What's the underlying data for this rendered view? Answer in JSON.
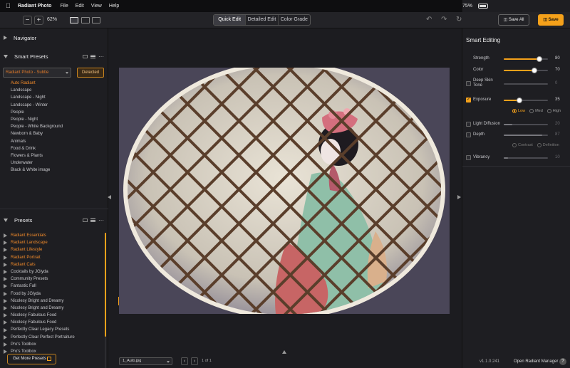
{
  "menubar": {
    "app_name": "Radiant Photo",
    "items": [
      "File",
      "Edit",
      "View",
      "Help"
    ],
    "battery": "75%"
  },
  "toolbar": {
    "zoom_minus": "−",
    "zoom_plus": "+",
    "zoom_level": "62%",
    "tabs": [
      "Quick Edit",
      "Detailed Edit",
      "Color Grade"
    ],
    "active_tab": "Quick Edit",
    "save_all_label": "Save All",
    "save_label": "Save"
  },
  "left_panel": {
    "navigator_title": "Navigator",
    "smart_presets_title": "Smart Presets",
    "dropdown_value": "Radiant Photo - Subtle",
    "detected_label": "Detected",
    "smart_presets": [
      "Auto Radiant",
      "Landscape",
      "Landscape - Night",
      "Landscape - Winter",
      "People",
      "People - Night",
      "People - White Background",
      "Newborn & Baby",
      "Animals",
      "Food & Drink",
      "Flowers & Plants",
      "Underwater",
      "Black & White image"
    ],
    "active_smart_preset": "Auto Radiant",
    "presets_title": "Presets",
    "preset_groups": [
      {
        "label": "Radiant Essentials",
        "highlight": true
      },
      {
        "label": "Radiant Landscape",
        "highlight": true
      },
      {
        "label": "Radiant Lifestyle",
        "highlight": true
      },
      {
        "label": "Radiant Portrait",
        "highlight": true
      },
      {
        "label": "Radiant Cats",
        "highlight": true
      },
      {
        "label": "Cocktails by JGlyda",
        "highlight": false
      },
      {
        "label": "Community Presets",
        "highlight": false
      },
      {
        "label": "Fantastic Fall",
        "highlight": false
      },
      {
        "label": "Food by JGlyda",
        "highlight": false
      },
      {
        "label": "Nicolesy Bright and Dreamy",
        "highlight": false
      },
      {
        "label": "Nicolesy Bright and Dreamy",
        "highlight": false
      },
      {
        "label": "Nicolesy Fabulous Food",
        "highlight": false
      },
      {
        "label": "Nicolesy Fabulous Food",
        "highlight": false
      },
      {
        "label": "Perfectly Clear Legacy Presets",
        "highlight": false
      },
      {
        "label": "Perfectly Clear Perfect Portraiture",
        "highlight": false
      },
      {
        "label": "Pro's Toolbox",
        "highlight": false
      },
      {
        "label": "Pro's Toolbox",
        "highlight": false
      }
    ],
    "get_more_label": "Get More Presets"
  },
  "canvas": {
    "file_name": "1_Auto.jpg",
    "page_count": "1 of 1"
  },
  "right_panel": {
    "title": "Smart Editing",
    "sliders": {
      "strength": {
        "label": "Strength",
        "value": "80",
        "fraction": 0.8
      },
      "color": {
        "label": "Color",
        "value": "70",
        "fraction": 0.7
      },
      "deep_skin_tone": {
        "label": "Deep Skin Tone",
        "value": "0",
        "fraction": 0.0
      },
      "exposure": {
        "label": "Exposure",
        "value": "35",
        "fraction": 0.35
      },
      "light_diffusion": {
        "label": "Light Diffusion",
        "value": "20",
        "fraction": 0.2
      },
      "depth": {
        "label": "Depth",
        "value": "87",
        "fraction": 0.87
      },
      "vibrancy": {
        "label": "Vibrancy",
        "value": "10",
        "fraction": 0.1
      }
    },
    "exposure_modes": [
      "Low",
      "Med",
      "High"
    ],
    "exposure_mode_selected": "Low",
    "depth_modes": [
      "Contrast",
      "Definition"
    ],
    "version": "v1.1.0.241",
    "open_manager_label": "Open Radiant Manager",
    "help_label": "?"
  },
  "colors": {
    "accent": "#f5a11a",
    "active_text": "#f08a2a",
    "background": "#1c1c20"
  }
}
